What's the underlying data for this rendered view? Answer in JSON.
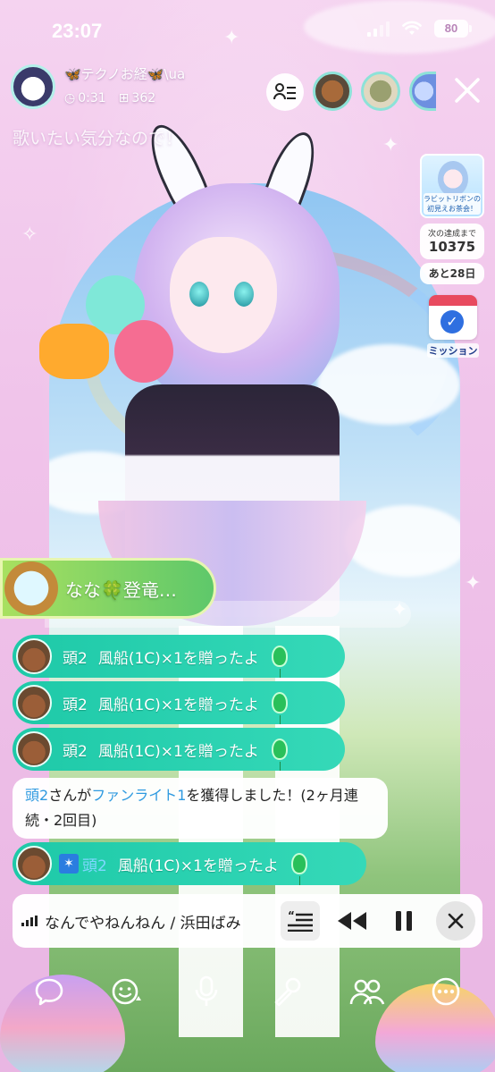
{
  "status_bar": {
    "time": "23:07",
    "battery": "80"
  },
  "host": {
    "name": "🦋テクノお経🦋\\ua",
    "duration": "0:31",
    "points": "362"
  },
  "subtitle": "歌いたい気分なので！",
  "right_panel": {
    "event_banner_text": "ラビットリボンの初見えお茶会！",
    "goal_label": "次の達成まで",
    "goal_value": "10375",
    "days_left": "あと28日",
    "mission_label": "ミッション"
  },
  "chat": {
    "entrance_text": "なな🍀登竜…",
    "messages": [
      {
        "user": "頭2",
        "gift": "風船(1C)×1を贈ったよ"
      },
      {
        "user": "頭2",
        "gift": "風船(1C)×1を贈ったよ"
      },
      {
        "user": "頭2",
        "gift": "風船(1C)×1を贈ったよ"
      }
    ],
    "fanlight": {
      "user": "頭2",
      "text_a": "さんが",
      "item": "ファンライト1",
      "text_b": "を獲得しました！(2ヶ月連続・2回目)"
    },
    "last_gift": {
      "user": "頭2",
      "gift": "風船(1C)×1を贈ったよ"
    }
  },
  "music": {
    "title": "なんでやねんねん / 浜田ばみ"
  },
  "colors": {
    "accent": "#1ec9a8",
    "background": "#f0c3ea",
    "mission_red": "#e84a5f"
  },
  "toolbar_icons": [
    "comment-icon",
    "emoji-icon",
    "mic-icon",
    "karaoke-mic-icon",
    "collab-icon",
    "more-icon"
  ]
}
